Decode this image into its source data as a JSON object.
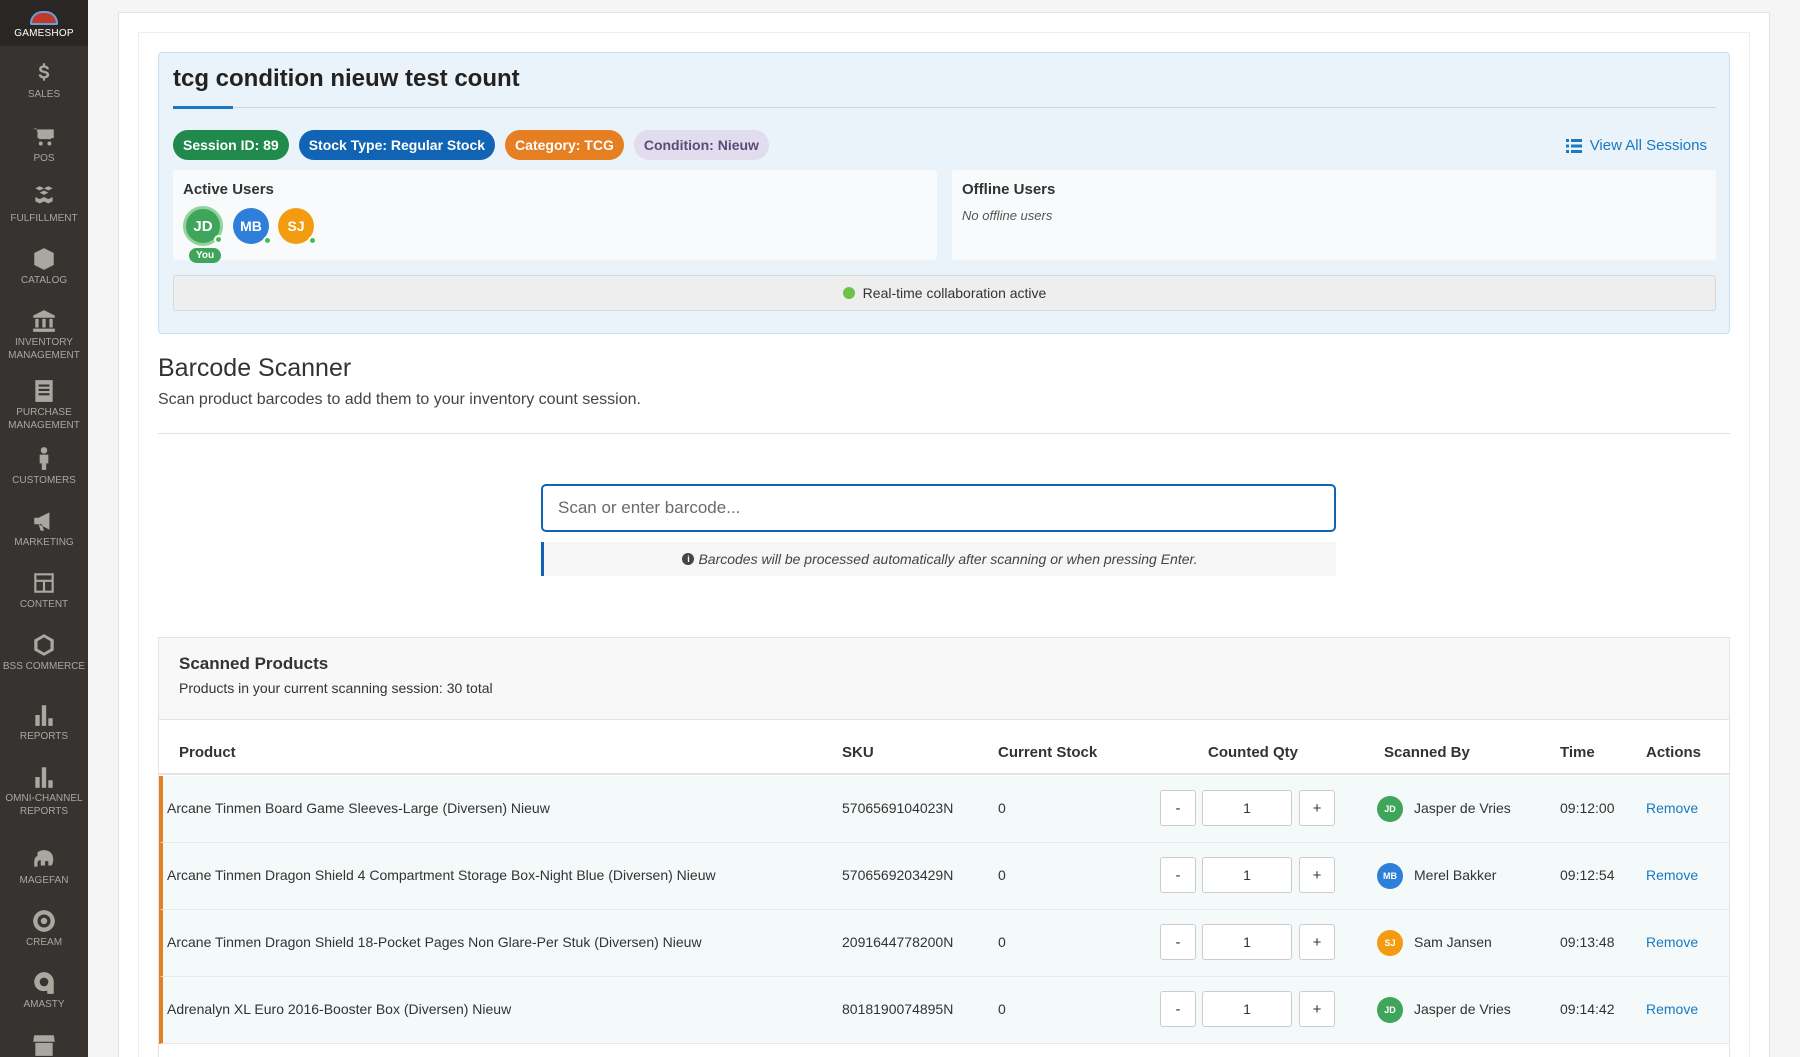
{
  "sidebar": {
    "logo_text": "GAMESHOP",
    "items": [
      {
        "label": "SALES",
        "icon": "dollar-icon"
      },
      {
        "label": "POS",
        "icon": "cart-icon"
      },
      {
        "label": "FULFILLMENT",
        "icon": "boxes-icon"
      },
      {
        "label": "CATALOG",
        "icon": "cube-icon"
      },
      {
        "label": "INVENTORY MANAGEMENT",
        "icon": "bank-icon"
      },
      {
        "label": "PURCHASE MANAGEMENT",
        "icon": "document-icon"
      },
      {
        "label": "CUSTOMERS",
        "icon": "person-icon"
      },
      {
        "label": "MARKETING",
        "icon": "megaphone-icon"
      },
      {
        "label": "CONTENT",
        "icon": "layout-icon"
      },
      {
        "label": "BSS COMMERCE",
        "icon": "hexagon-icon"
      },
      {
        "label": "REPORTS",
        "icon": "bar-chart-icon"
      },
      {
        "label": "OMNI-CHANNEL REPORTS",
        "icon": "bar-chart-icon"
      },
      {
        "label": "MAGEFAN",
        "icon": "elephant-icon"
      },
      {
        "label": "CREAM",
        "icon": "target-icon"
      },
      {
        "label": "AMASTY",
        "icon": "amasty-icon"
      }
    ]
  },
  "session": {
    "title": "tcg condition nieuw test count",
    "badges": {
      "session_id": "Session ID: 89",
      "stock_type": "Stock Type: Regular Stock",
      "category": "Category: TCG",
      "condition": "Condition: Nieuw"
    },
    "view_all": "View All Sessions",
    "active_users_title": "Active Users",
    "active_users": [
      "JD",
      "MB",
      "SJ"
    ],
    "you_label": "You",
    "offline_users_title": "Offline Users",
    "offline_note": "No offline users",
    "collab_status": "Real-time collaboration active"
  },
  "scanner": {
    "title": "Barcode Scanner",
    "subtitle": "Scan product barcodes to add them to your inventory count session.",
    "placeholder": "Scan or enter barcode...",
    "hint": "Barcodes will be processed automatically after scanning or when pressing Enter."
  },
  "products": {
    "title": "Scanned Products",
    "subtitle": "Products in your current scanning session: 30 total",
    "columns": {
      "product": "Product",
      "sku": "SKU",
      "stock": "Current Stock",
      "qty": "Counted Qty",
      "by": "Scanned By",
      "time": "Time",
      "actions": "Actions"
    },
    "minus_label": "-",
    "plus_label": "+",
    "remove_label": "Remove",
    "rows": [
      {
        "product": "Arcane Tinmen Board Game Sleeves-Large (Diversen) Nieuw",
        "sku": "5706569104023N",
        "stock": "0",
        "qty": "1",
        "initials": "JD",
        "by": "Jasper de Vries",
        "time": "09:12:00",
        "color": "#3fa55b"
      },
      {
        "product": "Arcane Tinmen Dragon Shield 4 Compartment Storage Box-Night Blue (Diversen) Nieuw",
        "sku": "5706569203429N",
        "stock": "0",
        "qty": "1",
        "initials": "MB",
        "by": "Merel Bakker",
        "time": "09:12:54",
        "color": "#2e7fd9"
      },
      {
        "product": "Arcane Tinmen Dragon Shield 18-Pocket Pages Non Glare-Per Stuk (Diversen) Nieuw",
        "sku": "2091644778200N",
        "stock": "0",
        "qty": "1",
        "initials": "SJ",
        "by": "Sam Jansen",
        "time": "09:13:48",
        "color": "#f39c12"
      },
      {
        "product": "Adrenalyn XL Euro 2016-Booster Box (Diversen) Nieuw",
        "sku": "8018190074895N",
        "stock": "0",
        "qty": "1",
        "initials": "JD",
        "by": "Jasper de Vries",
        "time": "09:14:42",
        "color": "#3fa55b"
      }
    ]
  }
}
